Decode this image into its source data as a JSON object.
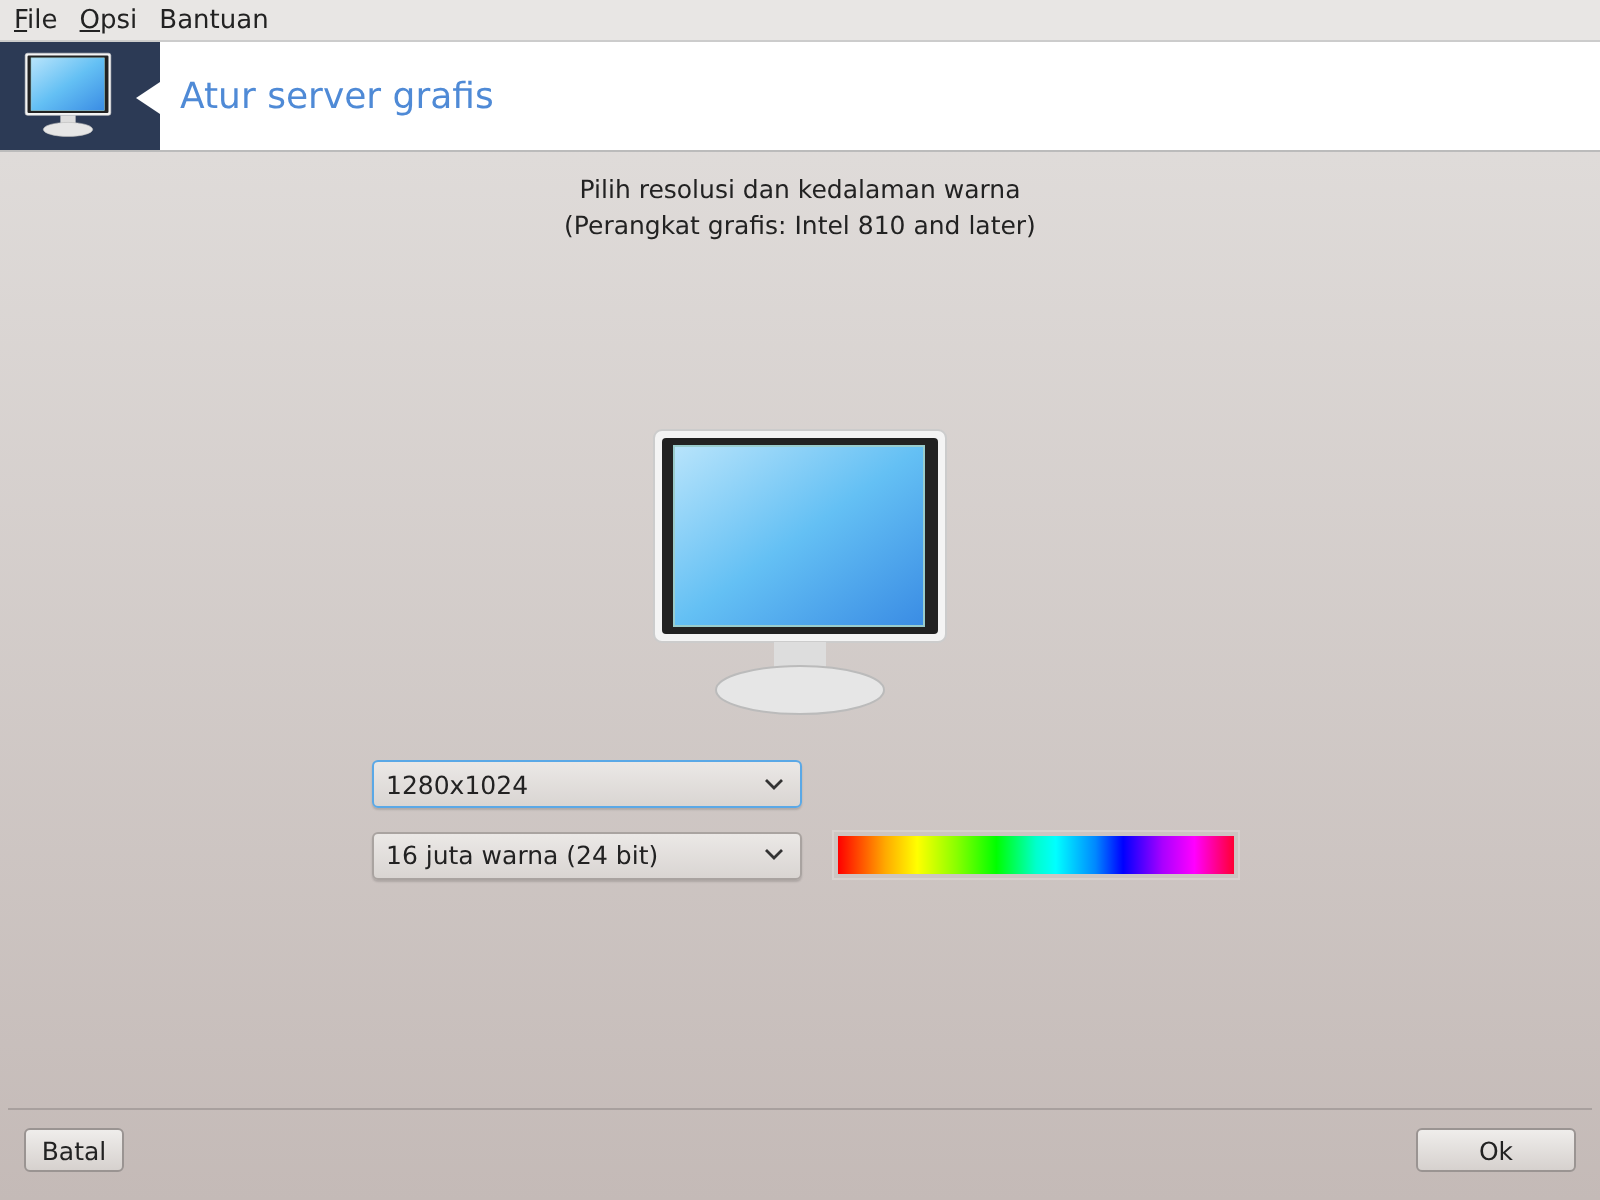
{
  "menu": [
    {
      "label": "File",
      "mnemonic": true
    },
    {
      "label": "Opsi",
      "mnemonic": true
    },
    {
      "label": "Bantuan",
      "mnemonic": false
    }
  ],
  "header": {
    "title": "Atur server grafis"
  },
  "intro": [
    "Pilih resolusi dan kedalaman warna",
    "(Perangkat grafis: Intel 810 and later)"
  ],
  "resolution": {
    "value": "1280x1024",
    "focused": true
  },
  "depth": {
    "value": "16 juta warna (24 bit)",
    "focused": false
  },
  "buttons": {
    "cancel": "Batal",
    "ok": "Ok"
  }
}
